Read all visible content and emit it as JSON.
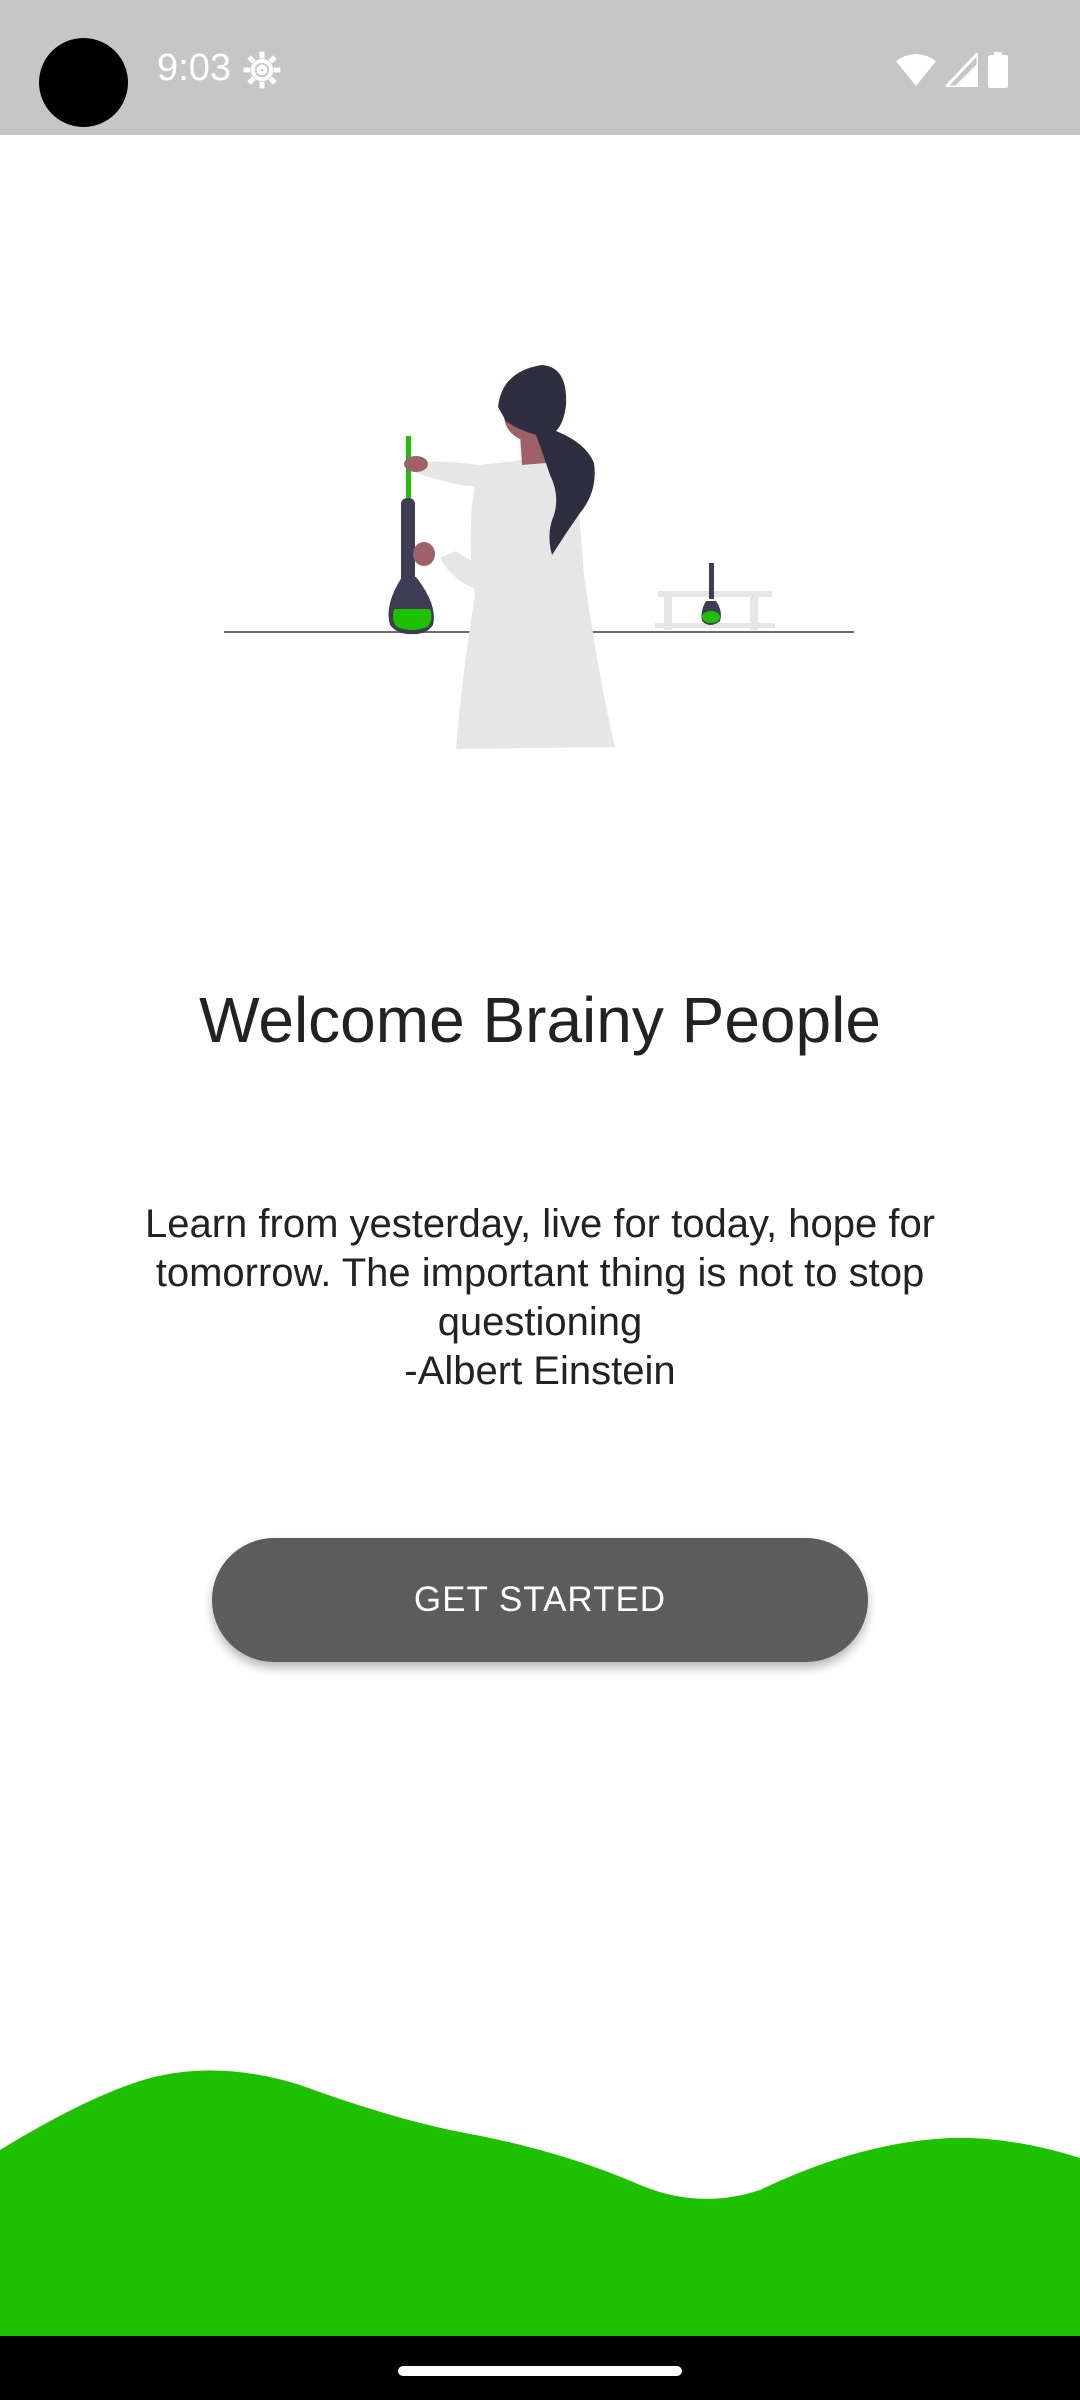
{
  "status_bar": {
    "time": "9:03",
    "icons": [
      "settings-icon",
      "wifi-icon",
      "cellular-signal-icon",
      "battery-icon"
    ]
  },
  "welcome": {
    "title": "Welcome Brainy People"
  },
  "quote": {
    "text": "Learn from yesterday, live for today, hope for tomorrow. The important thing is not to stop questioning",
    "author": "-Albert Einstein"
  },
  "button": {
    "get_started_label": "GET STARTED"
  },
  "colors": {
    "accent_green": "#1dc100",
    "button_gray": "#5c5c5c",
    "status_bar_gray": "#c6c6c6"
  }
}
